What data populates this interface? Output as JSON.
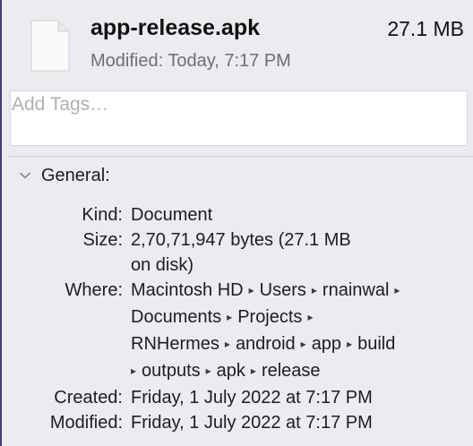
{
  "header": {
    "file_name": "app-release.apk",
    "file_size": "27.1 MB",
    "modified_label": "Modified:",
    "modified_value": "Today, 7:17 PM"
  },
  "tags": {
    "placeholder": "Add Tags…",
    "value": ""
  },
  "general": {
    "title": "General:",
    "expanded": true,
    "kind_label": "Kind:",
    "kind_value": "Document",
    "size_label": "Size:",
    "size_value_line1": "2,70,71,947 bytes (27.1 MB",
    "size_value_line2": "on disk)",
    "where_label": "Where:",
    "where_path": [
      "Macintosh HD",
      "Users",
      "rnainwal",
      "Documents",
      "Projects",
      "RNHermes",
      "android",
      "app",
      "build",
      "outputs",
      "apk",
      "release"
    ],
    "path_separator": "▸",
    "created_label": "Created:",
    "created_value": "Friday, 1 July 2022 at 7:17 PM",
    "modified_label": "Modified:",
    "modified_value": "Friday, 1 July 2022 at 7:17 PM"
  },
  "icons": {
    "file": "document-icon",
    "disclosure": "chevron-down-icon",
    "path_separator": "path-arrow-icon"
  },
  "colors": {
    "background": "#ecebef",
    "secondary_text": "#6e6e73",
    "window_edge": "#4a3d7a"
  }
}
